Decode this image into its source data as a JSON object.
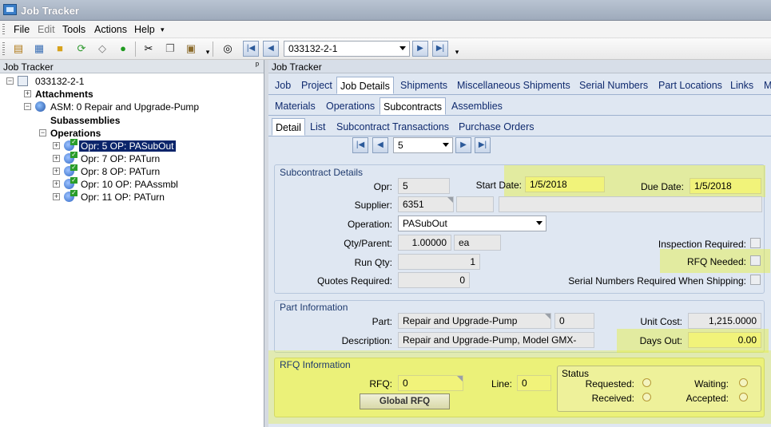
{
  "window": {
    "title": "Job Tracker"
  },
  "menu": [
    "File",
    "Edit",
    "Tools",
    "Actions",
    "Help"
  ],
  "toolbar": {
    "job_combo": "033132-2-1"
  },
  "left_panel": {
    "header": "Job Tracker",
    "pin": "ᵖ",
    "tree": {
      "root": "033132-2-1",
      "attachments": "Attachments",
      "assembly": "ASM: 0 Repair and Upgrade-Pump",
      "subassemblies": "Subassemblies",
      "operations": "Operations",
      "ops": [
        "Opr: 5 OP: PASubOut",
        "Opr: 7 OP: PATurn",
        "Opr: 8 OP: PATurn",
        "Opr: 10 OP: PAAssmbl",
        "Opr: 11 OP: PATurn"
      ]
    }
  },
  "right_panel": {
    "header": "Job Tracker",
    "tabs_l1": [
      "Job",
      "Project",
      "Job Details",
      "Shipments",
      "Miscellaneous Shipments",
      "Serial Numbers",
      "Part Locations",
      "Links",
      "M"
    ],
    "tabs_l2": [
      "Materials",
      "Operations",
      "Subcontracts",
      "Assemblies"
    ],
    "tabs_l3": [
      "Detail",
      "List",
      "Subcontract Transactions",
      "Purchase Orders"
    ],
    "nav_combo": "5",
    "subcontract": {
      "title": "Subcontract Details",
      "opr_label": "Opr:",
      "opr": "5",
      "start_label": "Start Date:",
      "start": "1/5/2018",
      "due_label": "Due Date:",
      "due": "1/5/2018",
      "supplier_label": "Supplier:",
      "supplier": "6351",
      "operation_label": "Operation:",
      "operation": "PASubOut",
      "qty_label": "Qty/Parent:",
      "qty": "1.00000",
      "uom": "ea",
      "run_label": "Run Qty:",
      "run": "1",
      "quotes_label": "Quotes Required:",
      "quotes": "0",
      "inspection_label": "Inspection Required:",
      "rfq_needed_label": "RFQ Needed:",
      "serial_label": "Serial Numbers Required When Shipping:"
    },
    "part": {
      "title": "Part Information",
      "part_label": "Part:",
      "part": "Repair and Upgrade-Pump",
      "rev": "0",
      "desc_label": "Description:",
      "desc": "Repair and Upgrade-Pump, Model GMX-",
      "cost_label": "Unit Cost:",
      "cost": "1,215.0000",
      "days_label": "Days Out:",
      "days": "0.00"
    },
    "rfq": {
      "title": "RFQ Information",
      "rfq_label": "RFQ:",
      "rfq": "0",
      "line_label": "Line:",
      "line": "0",
      "button": "Global RFQ",
      "status_title": "Status",
      "requested": "Requested:",
      "received": "Received:",
      "waiting": "Waiting:",
      "accepted": "Accepted:"
    }
  },
  "colors": {
    "highlight": "#e6f03c",
    "panel": "#dfe7f2",
    "selection": "#0a246a"
  }
}
